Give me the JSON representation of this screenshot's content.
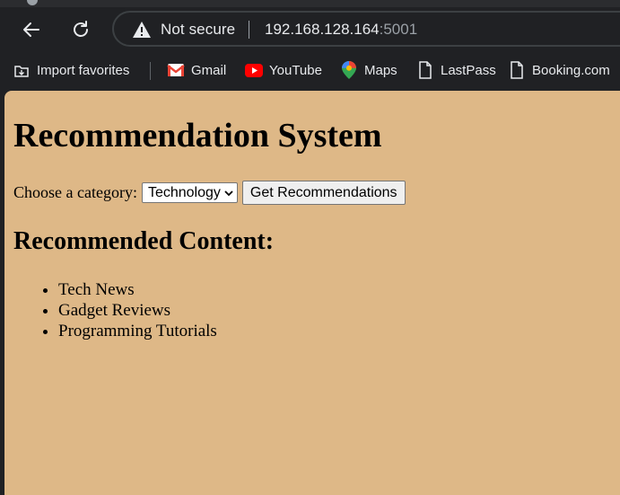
{
  "browser": {
    "security_label": "Not secure",
    "url_host": "192.168.128.164",
    "url_port": ":5001",
    "bookmarks": [
      {
        "label": "Import favorites",
        "icon": "import-icon"
      },
      {
        "label": "Gmail",
        "icon": "gmail-icon"
      },
      {
        "label": "YouTube",
        "icon": "youtube-icon"
      },
      {
        "label": "Maps",
        "icon": "maps-icon"
      },
      {
        "label": "LastPass",
        "icon": "page-icon"
      },
      {
        "label": "Booking.com",
        "icon": "page-icon"
      }
    ]
  },
  "page": {
    "title": "Recommendation System",
    "category_label": "Choose a category:",
    "category_selected": "Technology",
    "submit_label": "Get Recommendations",
    "results_heading": "Recommended Content:",
    "results": [
      "Tech News",
      "Gadget Reviews",
      "Programming Tutorials"
    ],
    "background_color": "#deb887"
  }
}
